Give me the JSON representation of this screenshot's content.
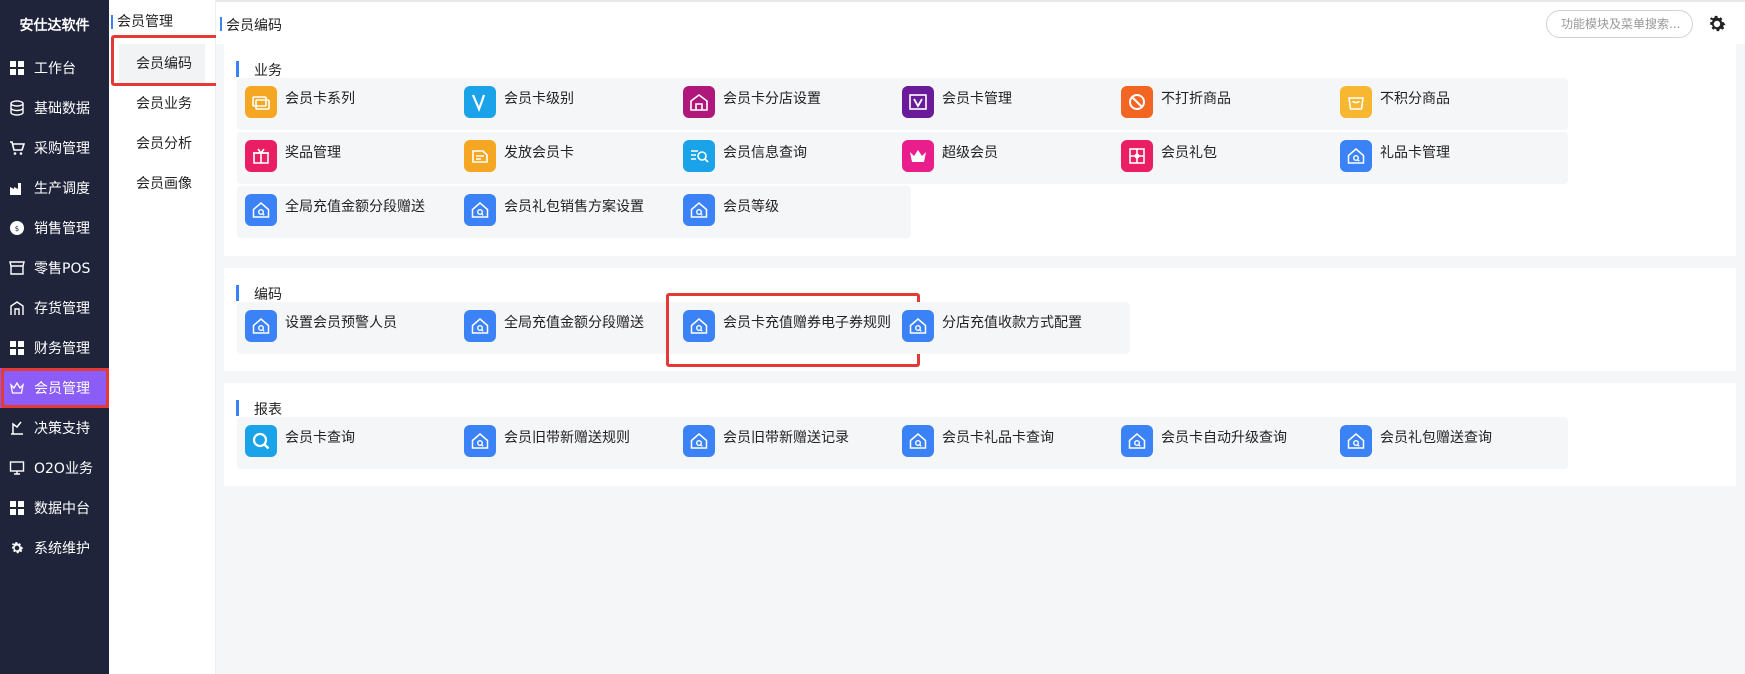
{
  "app": {
    "brand": "安仕达软件"
  },
  "leftnav": [
    {
      "label": "工作台",
      "icon": "grid-icon"
    },
    {
      "label": "基础数据",
      "icon": "database-icon"
    },
    {
      "label": "采购管理",
      "icon": "cart-icon"
    },
    {
      "label": "生产调度",
      "icon": "factory-icon"
    },
    {
      "label": "销售管理",
      "icon": "sales-icon"
    },
    {
      "label": "零售POS",
      "icon": "store-icon"
    },
    {
      "label": "存货管理",
      "icon": "warehouse-icon"
    },
    {
      "label": "财务管理",
      "icon": "grid-icon"
    },
    {
      "label": "会员管理",
      "icon": "crown-icon",
      "active": true
    },
    {
      "label": "决策支持",
      "icon": "decision-icon"
    },
    {
      "label": "O2O业务",
      "icon": "monitor-icon"
    },
    {
      "label": "数据中台",
      "icon": "grid-icon"
    },
    {
      "label": "系统维护",
      "icon": "gear-icon"
    }
  ],
  "subnav": {
    "title": "会员管理",
    "items": [
      "会员编码",
      "会员业务",
      "会员分析",
      "会员画像"
    ],
    "active_index": 0
  },
  "topbar": {
    "breadcrumb": "会员编码",
    "search_placeholder": "功能模块及菜单搜索..."
  },
  "sections": [
    {
      "title": "业务",
      "cards": [
        {
          "label": "会员卡系列",
          "icon": "card-series-icon",
          "color": "#f5a623"
        },
        {
          "label": "会员卡级别",
          "icon": "v-level-icon",
          "color": "#1aa3e8"
        },
        {
          "label": "会员卡分店设置",
          "icon": "store-house-icon",
          "color": "#b0177a"
        },
        {
          "label": "会员卡管理",
          "icon": "v-card-icon",
          "color": "#6a1b9a"
        },
        {
          "label": "不打折商品",
          "icon": "no-discount-icon",
          "color": "#f26522"
        },
        {
          "label": "不积分商品",
          "icon": "bag-icon",
          "color": "#f7b731"
        },
        {
          "label": "奖品管理",
          "icon": "gift-box-icon",
          "color": "#e91e63"
        },
        {
          "label": "发放会员卡",
          "icon": "issue-card-icon",
          "color": "#f5a623"
        },
        {
          "label": "会员信息查询",
          "icon": "info-search-icon",
          "color": "#1aa3e8"
        },
        {
          "label": "超级会员",
          "icon": "crown-icon",
          "color": "#e91e8c"
        },
        {
          "label": "会员礼包",
          "icon": "gift-package-icon",
          "color": "#e91e63"
        },
        {
          "label": "礼品卡管理",
          "icon": "home-default-icon",
          "color": "#3b82f6"
        },
        {
          "label": "全局充值金额分段赠送",
          "icon": "home-default-icon",
          "color": "#3b82f6"
        },
        {
          "label": "会员礼包销售方案设置",
          "icon": "home-default-icon",
          "color": "#3b82f6"
        },
        {
          "label": "会员等级",
          "icon": "home-default-icon",
          "color": "#3b82f6"
        }
      ]
    },
    {
      "title": "编码",
      "cards": [
        {
          "label": "设置会员预警人员",
          "icon": "home-default-icon",
          "color": "#3b82f6"
        },
        {
          "label": "全局充值金额分段赠送",
          "icon": "home-default-icon",
          "color": "#3b82f6"
        },
        {
          "label": "会员卡充值赠券电子券规则",
          "icon": "home-default-icon",
          "color": "#3b82f6",
          "highlight": true
        },
        {
          "label": "分店充值收款方式配置",
          "icon": "home-default-icon",
          "color": "#3b82f6"
        }
      ]
    },
    {
      "title": "报表",
      "cards": [
        {
          "label": "会员卡查询",
          "icon": "search-circle-icon",
          "color": "#1aa3e8"
        },
        {
          "label": "会员旧带新赠送规则",
          "icon": "home-default-icon",
          "color": "#3b82f6"
        },
        {
          "label": "会员旧带新赠送记录",
          "icon": "home-default-icon",
          "color": "#3b82f6"
        },
        {
          "label": "会员卡礼品卡查询",
          "icon": "home-default-icon",
          "color": "#3b82f6"
        },
        {
          "label": "会员卡自动升级查询",
          "icon": "home-default-icon",
          "color": "#3b82f6"
        },
        {
          "label": "会员礼包赠送查询",
          "icon": "home-default-icon",
          "color": "#3b82f6"
        }
      ]
    }
  ]
}
